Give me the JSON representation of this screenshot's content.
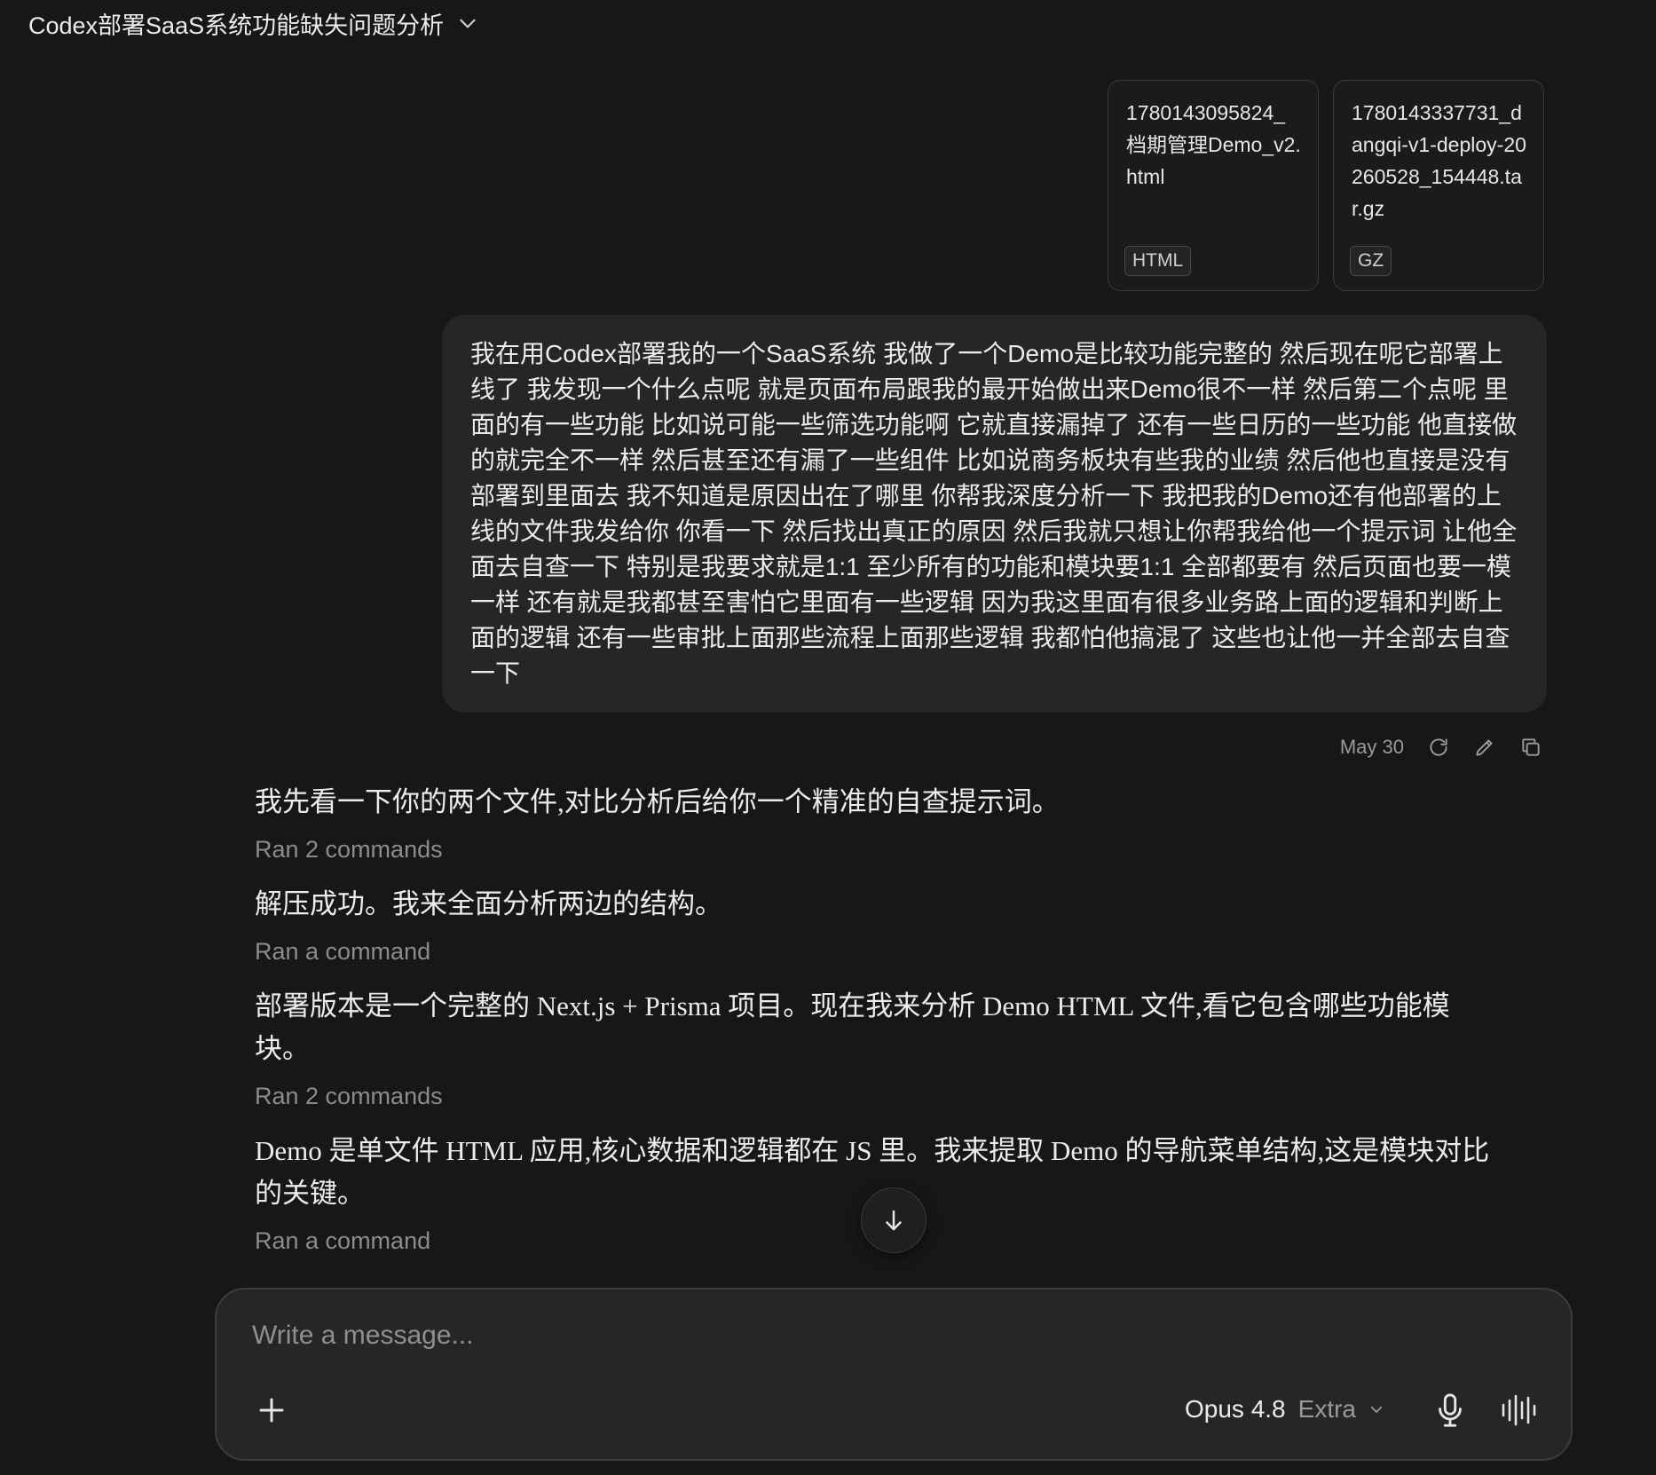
{
  "header": {
    "title": "Codex部署SaaS系统功能缺失问题分析"
  },
  "attachments": [
    {
      "name": "1780143095824_档期管理Demo_v2.html",
      "badge": "HTML"
    },
    {
      "name": "1780143337731_dangqi-v1-deploy-20260528_154448.tar.gz",
      "badge": "GZ"
    }
  ],
  "user_message": {
    "text": "我在用Codex部署我的一个SaaS系统 我做了一个Demo是比较功能完整的 然后现在呢它部署上线了 我发现一个什么点呢 就是页面布局跟我的最开始做出来Demo很不一样 然后第二个点呢 里面的有一些功能 比如说可能一些筛选功能啊 它就直接漏掉了 还有一些日历的一些功能 他直接做的就完全不一样 然后甚至还有漏了一些组件 比如说商务板块有些我的业绩 然后他也直接是没有部署到里面去 我不知道是原因出在了哪里 你帮我深度分析一下 我把我的Demo还有他部署的上线的文件我发给你 你看一下 然后找出真正的原因 然后我就只想让你帮我给他一个提示词 让他全面去自查一下 特别是我要求就是1:1 至少所有的功能和模块要1:1 全部都要有 然后页面也要一模一样 还有就是我都甚至害怕它里面有一些逻辑 因为我这里面有很多业务路上面的逻辑和判断上面的逻辑 还有一些审批上面那些流程上面那些逻辑 我都怕他搞混了 这些也让他一并全部去自查一下",
    "date": "May 30"
  },
  "assistant": {
    "blocks": [
      {
        "kind": "text",
        "text": "我先看一下你的两个文件,对比分析后给你一个精准的自查提示词。"
      },
      {
        "kind": "command",
        "text": "Ran 2 commands"
      },
      {
        "kind": "text",
        "text": "解压成功。我来全面分析两边的结构。"
      },
      {
        "kind": "command",
        "text": "Ran a command"
      },
      {
        "kind": "text",
        "text": "部署版本是一个完整的 Next.js + Prisma 项目。现在我来分析 Demo HTML 文件,看它包含哪些功能模块。"
      },
      {
        "kind": "command",
        "text": "Ran 2 commands"
      },
      {
        "kind": "text",
        "text": "Demo 是单文件 HTML 应用,核心数据和逻辑都在 JS 里。我来提取 Demo 的导航菜单结构,这是模块对比的关键。"
      },
      {
        "kind": "command",
        "text": "Ran a command"
      }
    ]
  },
  "composer": {
    "placeholder": "Write a message...",
    "model": "Opus 4.8",
    "mode": "Extra"
  }
}
